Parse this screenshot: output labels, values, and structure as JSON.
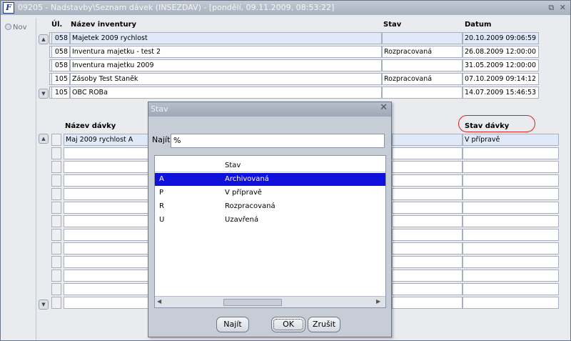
{
  "window": {
    "title": "09205 - Nadstavby\\Seznam dávek (INSEZDAV) - [pondělí, 09.11.2009, 08:53:22]",
    "app_icon": "F",
    "controls": [
      "⧉",
      "✕"
    ]
  },
  "left_panel": {
    "nav_label": "Nov"
  },
  "inventory_table": {
    "columns": [
      "Úl.",
      "Název inventury",
      "Stav",
      "Datum"
    ],
    "rows": [
      {
        "ul": "058",
        "name": "Majetek 2009 rychlost",
        "stav": "",
        "datum": "20.10.2009 09:06:59"
      },
      {
        "ul": "058",
        "name": "Inventura majetku - test 2",
        "stav": "Rozpracovaná",
        "datum": "26.08.2009 12:00:00"
      },
      {
        "ul": "058",
        "name": "Inventura majetku 2009",
        "stav": "",
        "datum": "31.05.2009 12:00:00"
      },
      {
        "ul": "105",
        "name": "Zásoby Test Staněk",
        "stav": "Rozpracovaná",
        "datum": "07.10.2009 09:14:12"
      },
      {
        "ul": "105",
        "name": "OBC ROBa",
        "stav": "",
        "datum": "14.07.2009 15:46:53"
      }
    ]
  },
  "batch_table": {
    "columns": [
      "Název dávky",
      "Stav dávky"
    ],
    "rows": [
      {
        "name": "Maj 2009 rychlost A",
        "stav": "V přípravě"
      }
    ]
  },
  "dialog": {
    "title": "Stav",
    "find_label": "Najít",
    "find_value": "%",
    "list_header": [
      "",
      "Stav"
    ],
    "items": [
      {
        "code": "A",
        "label": "Archivovaná",
        "selected": true
      },
      {
        "code": "P",
        "label": "V přípravě",
        "selected": false
      },
      {
        "code": "R",
        "label": "Rozpracovaná",
        "selected": false
      },
      {
        "code": "U",
        "label": "Uzavřená",
        "selected": false
      }
    ],
    "buttons": {
      "find": "Najít",
      "ok": "OK",
      "cancel": "Zrušit"
    }
  },
  "colors": {
    "selection": "#1010dd",
    "highlight_circle": "#d82020",
    "row_selected": "#dfe9f7"
  }
}
